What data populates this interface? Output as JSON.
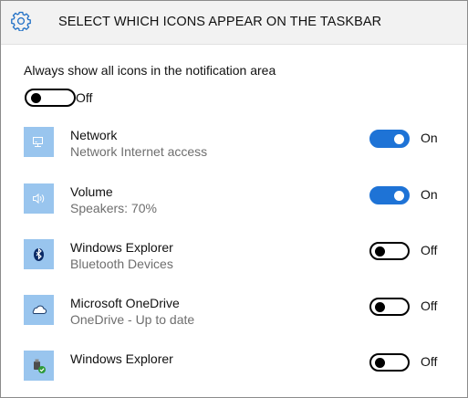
{
  "header": {
    "title": "SELECT WHICH ICONS APPEAR ON THE TASKBAR",
    "icon": "gear-icon",
    "background": "#f2f2f2"
  },
  "always_show": {
    "label": "Always show all icons in the notification area",
    "state": "Off",
    "on": false
  },
  "accent": "#1e73d6",
  "icon_tile_color": "#99c5ee",
  "items": [
    {
      "name": "Network",
      "subtitle": "Network Internet access",
      "state": "On",
      "on": true,
      "icon": "network-icon"
    },
    {
      "name": "Volume",
      "subtitle": "Speakers: 70%",
      "state": "On",
      "on": true,
      "icon": "volume-icon"
    },
    {
      "name": "Windows Explorer",
      "subtitle": "Bluetooth Devices",
      "state": "Off",
      "on": false,
      "icon": "bluetooth-icon"
    },
    {
      "name": "Microsoft OneDrive",
      "subtitle": "OneDrive - Up to date",
      "state": "Off",
      "on": false,
      "icon": "onedrive-cloud-icon"
    },
    {
      "name": "Windows Explorer",
      "subtitle": "",
      "state": "Off",
      "on": false,
      "icon": "safely-remove-hardware-icon"
    }
  ]
}
